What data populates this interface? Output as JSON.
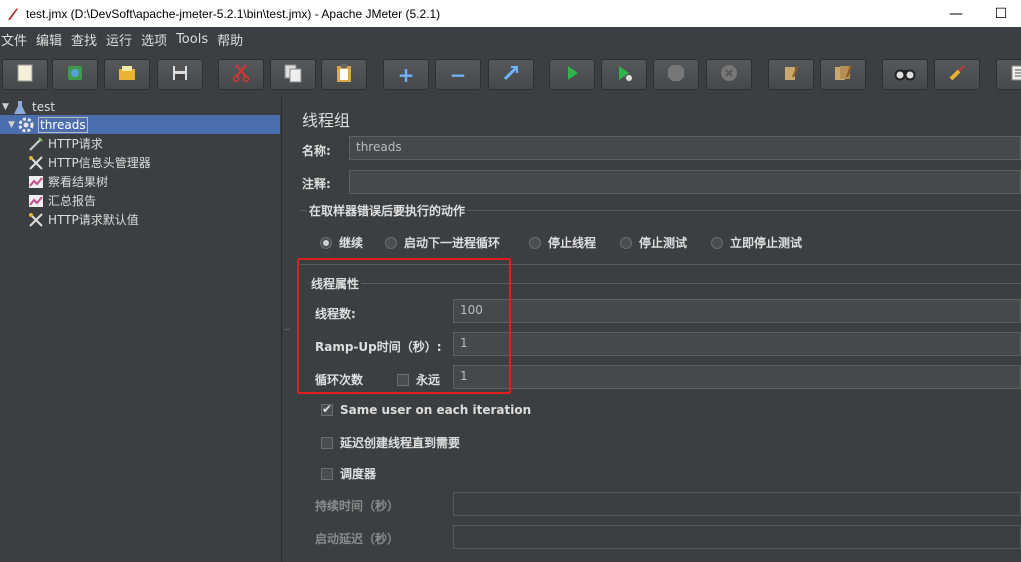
{
  "window": {
    "title": "test.jmx (D:\\DevSoft\\apache-jmeter-5.2.1\\bin\\test.jmx) - Apache JMeter (5.2.1)",
    "minimize": "—",
    "maximize": "☐"
  },
  "menu": [
    "文件",
    "编辑",
    "查找",
    "运行",
    "选项",
    "Tools",
    "帮助"
  ],
  "toolbar": [
    {
      "name": "new-icon"
    },
    {
      "name": "templates-icon"
    },
    {
      "name": "open-icon"
    },
    {
      "name": "save-icon"
    },
    {
      "name": "cut-icon"
    },
    {
      "name": "copy-icon"
    },
    {
      "name": "paste-icon"
    },
    {
      "name": "expand-icon",
      "glyph": "+"
    },
    {
      "name": "collapse-icon",
      "glyph": "−"
    },
    {
      "name": "toggle-icon"
    },
    {
      "name": "start-icon"
    },
    {
      "name": "start-no-pauses-icon"
    },
    {
      "name": "stop-icon"
    },
    {
      "name": "shutdown-icon"
    },
    {
      "name": "clear-icon"
    },
    {
      "name": "clear-all-icon"
    },
    {
      "name": "search-icon"
    },
    {
      "name": "reset-search-icon"
    },
    {
      "name": "function-helper-icon"
    }
  ],
  "tree": {
    "items": [
      {
        "label": "test",
        "icon": "test-plan-icon",
        "level": 0,
        "expanded": true
      },
      {
        "label": "threads",
        "icon": "thread-group-icon",
        "level": 1,
        "expanded": true,
        "selected": true
      },
      {
        "label": "HTTP请求",
        "icon": "sampler-icon",
        "level": 2
      },
      {
        "label": "HTTP信息头管理器",
        "icon": "config-icon",
        "level": 2
      },
      {
        "label": "察看结果树",
        "icon": "listener-icon",
        "level": 2
      },
      {
        "label": "汇总报告",
        "icon": "listener-icon",
        "level": 2
      },
      {
        "label": "HTTP请求默认值",
        "icon": "config-icon",
        "level": 2
      }
    ]
  },
  "panel": {
    "title": "线程组",
    "name_label": "名称:",
    "name_value": "threads",
    "comment_label": "注释:",
    "comment_value": "",
    "error_group": {
      "title": "在取样器错误后要执行的动作",
      "options": [
        "继续",
        "启动下一进程循环",
        "停止线程",
        "停止测试",
        "立即停止测试"
      ],
      "selected": "继续"
    },
    "thread_props": {
      "title": "线程属性",
      "threads_label": "线程数:",
      "threads_value": "100",
      "rampup_label": "Ramp-Up时间（秒）:",
      "rampup_value": "1",
      "loop_label": "循环次数",
      "forever_label": "永远",
      "forever_checked": false,
      "loop_value": "1"
    },
    "same_user": {
      "label": "Same user on each iteration",
      "checked": true
    },
    "delay_create": {
      "label": "延迟创建线程直到需要",
      "checked": false
    },
    "scheduler": {
      "label": "调度器",
      "checked": false
    },
    "duration_label": "持续时间（秒）",
    "duration_value": "",
    "startup_delay_label": "启动延迟（秒）",
    "startup_delay_value": ""
  },
  "colors": {
    "background": "#3c3f41",
    "selection": "#4b6eaf",
    "highlight_box": "#e02020"
  }
}
